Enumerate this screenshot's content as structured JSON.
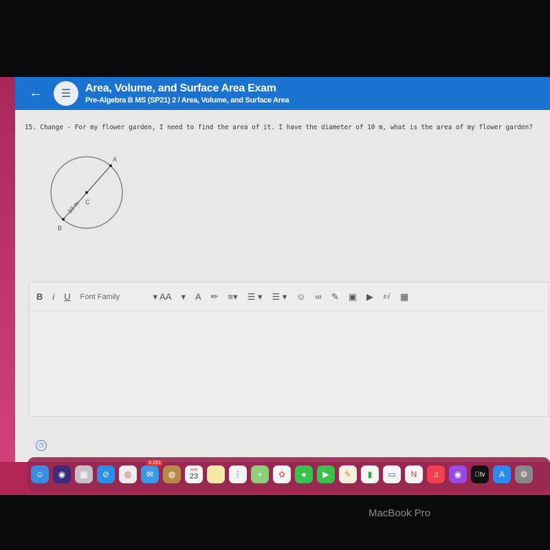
{
  "header": {
    "title": "Area, Volume, and Surface Area Exam",
    "subtitle": "Pre-Algebra B MS (SP21) 2 / Area, Volume, and Surface Area",
    "back_icon": "arrow-left-icon",
    "app_icon": "list-icon"
  },
  "question": {
    "text": "15. Change - For my flower garden, I need to find the area of it.  I have the diameter of 10 m, what is the area of my flower garden?",
    "diagram": {
      "point_a": "A",
      "point_b": "B",
      "point_c": "C",
      "diameter_label": "10 m"
    }
  },
  "toolbar": {
    "bold": "B",
    "italic": "i",
    "underline": "U",
    "font_family": "Font Family",
    "font_size": "AA",
    "font_color": "A",
    "plus_minus": "±√"
  },
  "dock": {
    "mail_badge": "8,251",
    "calendar_month": "APR",
    "calendar_day": "23",
    "tv_label": "tv"
  },
  "device": {
    "brand": "MacBook Pro"
  },
  "colors": {
    "header": "#1a73d0",
    "dock": "#962850"
  }
}
